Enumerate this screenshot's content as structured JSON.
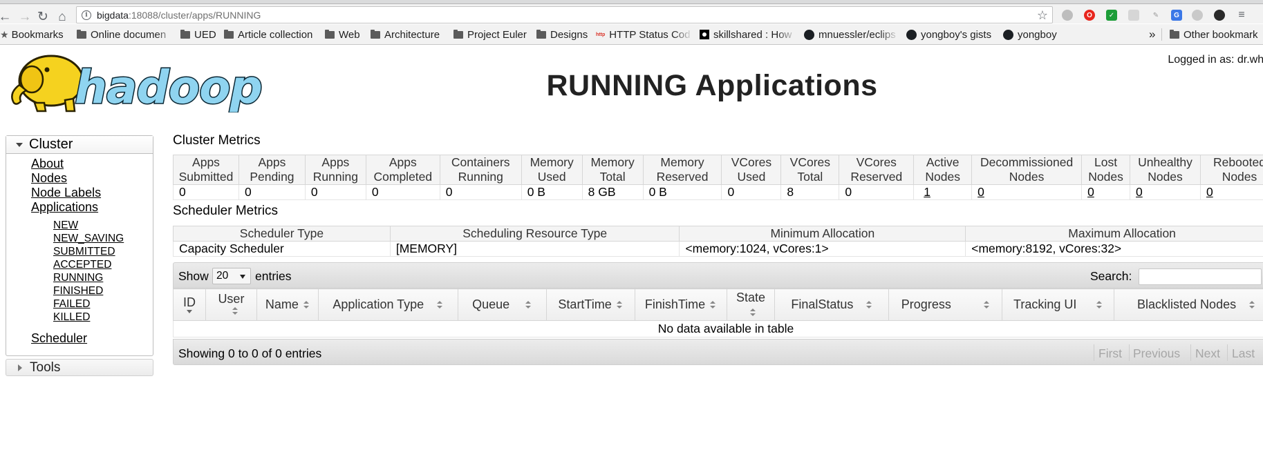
{
  "browser": {
    "url_host": "bigdata",
    "url_rest": ":18088/cluster/apps/RUNNING",
    "bookmarks": [
      {
        "label": "Bookmarks",
        "icon": "star-icon"
      },
      {
        "label": "Online documen",
        "icon": "folder-icon"
      },
      {
        "label": "UED",
        "icon": "folder-icon"
      },
      {
        "label": "Article collection",
        "icon": "folder-icon"
      },
      {
        "label": "Web",
        "icon": "folder-icon"
      },
      {
        "label": "Architecture",
        "icon": "folder-icon"
      },
      {
        "label": "Project Euler",
        "icon": "folder-icon"
      },
      {
        "label": "Designs",
        "icon": "folder-icon"
      },
      {
        "label": "HTTP Status Cod",
        "icon": "http-icon"
      },
      {
        "label": "skillshared : How",
        "icon": "skillshared-icon"
      },
      {
        "label": "mnuessler/eclips",
        "icon": "github-icon"
      },
      {
        "label": "yongboy's gists",
        "icon": "github-icon"
      },
      {
        "label": "yongboy",
        "icon": "github-icon"
      }
    ],
    "overflow_chevron": "»",
    "other_bookmarks": "Other bookmark"
  },
  "header": {
    "logo_text": "hadoop",
    "title": "RUNNING Applications",
    "logged_in": "Logged in as: dr.who"
  },
  "nav": {
    "cluster_label": "Cluster",
    "links": [
      "About",
      "Nodes",
      "Node Labels",
      "Applications"
    ],
    "states": [
      "NEW",
      "NEW_SAVING",
      "SUBMITTED",
      "ACCEPTED",
      "RUNNING",
      "FINISHED",
      "FAILED",
      "KILLED"
    ],
    "scheduler": "Scheduler",
    "tools_label": "Tools"
  },
  "cluster_metrics": {
    "title": "Cluster Metrics",
    "headers": [
      [
        "Apps",
        "Submitted"
      ],
      [
        "Apps",
        "Pending"
      ],
      [
        "Apps",
        "Running"
      ],
      [
        "Apps",
        "Completed"
      ],
      [
        "Containers",
        "Running"
      ],
      [
        "Memory",
        "Used"
      ],
      [
        "Memory",
        "Total"
      ],
      [
        "Memory",
        "Reserved"
      ],
      [
        "VCores",
        "Used"
      ],
      [
        "VCores",
        "Total"
      ],
      [
        "VCores",
        "Reserved"
      ],
      [
        "Active",
        "Nodes"
      ],
      [
        "Decommissioned",
        "Nodes"
      ],
      [
        "Lost",
        "Nodes"
      ],
      [
        "Unhealthy",
        "Nodes"
      ],
      [
        "Rebooted",
        "Nodes"
      ]
    ],
    "values": [
      "0",
      "0",
      "0",
      "0",
      "0",
      "0 B",
      "8 GB",
      "0 B",
      "0",
      "8",
      "0",
      "1",
      "0",
      "0",
      "0",
      "0"
    ]
  },
  "scheduler_metrics": {
    "title": "Scheduler Metrics",
    "headers": [
      "Scheduler Type",
      "Scheduling Resource Type",
      "Minimum Allocation",
      "Maximum Allocation"
    ],
    "values": [
      "Capacity Scheduler",
      "[MEMORY]",
      "<memory:1024, vCores:1>",
      "<memory:8192, vCores:32>"
    ]
  },
  "apps": {
    "show_label": "Show",
    "page_size": "20",
    "entries_label": "entries",
    "search_label": "Search:",
    "search_value": "",
    "columns": [
      "ID",
      "User",
      "Name",
      "Application Type",
      "Queue",
      "StartTime",
      "FinishTime",
      "State",
      "FinalStatus",
      "Progress",
      "Tracking UI",
      "Blacklisted Nodes"
    ],
    "empty_message": "No data available in table",
    "showing": "Showing 0 to 0 of 0 entries",
    "pager": [
      "First",
      "Previous",
      "Next",
      "Last"
    ]
  }
}
